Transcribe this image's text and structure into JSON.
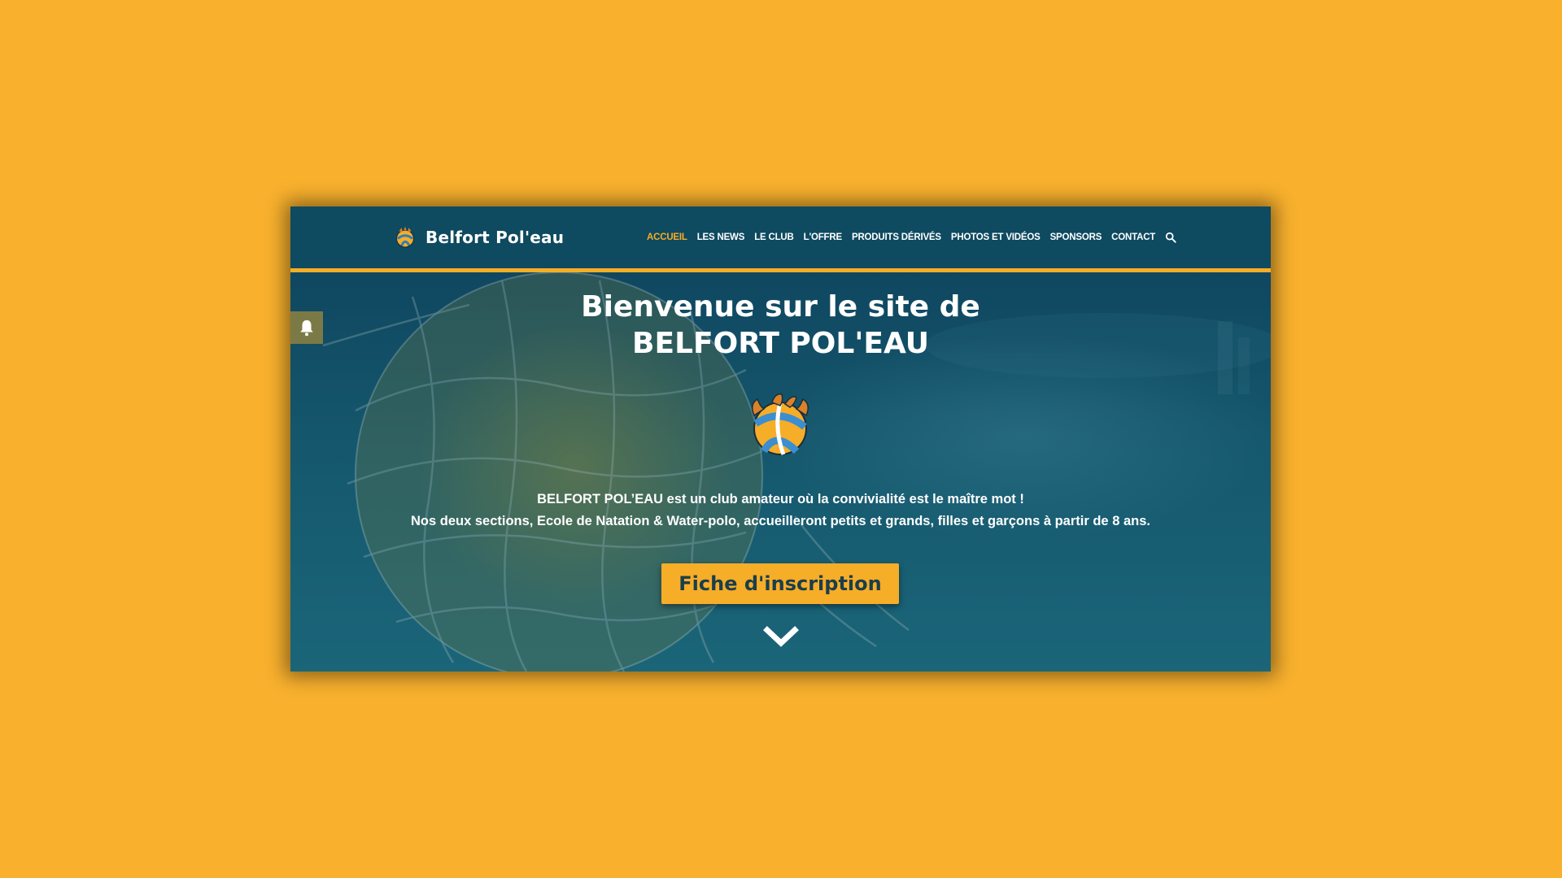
{
  "site": {
    "name": "Belfort Pol'eau"
  },
  "nav": {
    "items": [
      {
        "label": "ACCUEIL",
        "active": true
      },
      {
        "label": "LES NEWS",
        "active": false
      },
      {
        "label": "LE CLUB",
        "active": false
      },
      {
        "label": "L'OFFRE",
        "active": false
      },
      {
        "label": "PRODUITS DÉRIVÉS",
        "active": false
      },
      {
        "label": "PHOTOS ET VIDÉOS",
        "active": false
      },
      {
        "label": "SPONSORS",
        "active": false
      },
      {
        "label": "CONTACT",
        "active": false
      }
    ],
    "search_icon": "search-icon"
  },
  "hero": {
    "title_line1": "Bienvenue sur le site de",
    "title_line2": "BELFORT POL'EAU",
    "text_line1": "BELFORT POL’EAU est un club amateur où la convivialité est le maître mot !",
    "text_line2": "Nos deux sections, Ecole de Natation & Water-polo, accueilleront petits et grands, filles et garçons à partir de 8 ans.",
    "cta_label": "Fiche d'inscription",
    "scroll_icon": "chevron-down-icon",
    "notification_icon": "bell-icon"
  },
  "colors": {
    "page_background": "#f8b02d",
    "header_background": "#0e4a60",
    "accent": "#f6ad27",
    "cta_text": "#1a3e4c",
    "bell_tab": "#7b7a46"
  }
}
